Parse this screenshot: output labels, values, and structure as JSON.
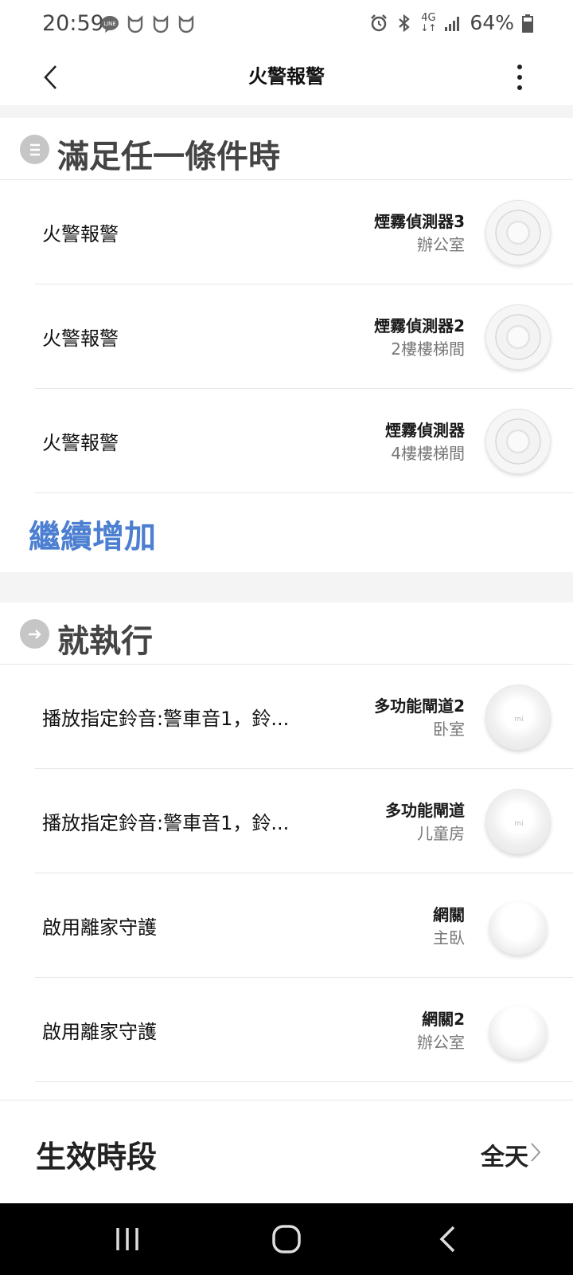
{
  "status_bar": {
    "time": "20:59",
    "battery": "64%",
    "network": "4G"
  },
  "app_bar": {
    "title": "火警報警"
  },
  "conditions": {
    "header": "滿足任一條件時",
    "items": [
      {
        "label": "火警報警",
        "device": "煙霧偵測器3",
        "room": "辦公室",
        "icon": "smoke-detector-icon"
      },
      {
        "label": "火警報警",
        "device": "煙霧偵測器2",
        "room": "2樓樓梯間",
        "icon": "smoke-detector-icon"
      },
      {
        "label": "火警報警",
        "device": "煙霧偵測器",
        "room": "4樓樓梯間",
        "icon": "smoke-detector-icon"
      }
    ],
    "add_more": "繼續增加"
  },
  "actions": {
    "header": "就執行",
    "items": [
      {
        "label": "播放指定鈴音:警車音1，鈴...",
        "device": "多功能閘道2",
        "room": "卧室",
        "icon": "hub-icon"
      },
      {
        "label": "播放指定鈴音:警車音1，鈴...",
        "device": "多功能閘道",
        "room": "儿童房",
        "icon": "hub-icon"
      },
      {
        "label": "啟用離家守護",
        "device": "網關",
        "room": "主臥",
        "icon": "gateway-icon"
      },
      {
        "label": "啟用離家守護",
        "device": "網關2",
        "room": "辦公室",
        "icon": "gateway-icon"
      }
    ]
  },
  "period": {
    "label": "生效時段",
    "value": "全天"
  },
  "colors": {
    "accent": "#4c7fd1",
    "section_icon": "#c6c6c6"
  }
}
